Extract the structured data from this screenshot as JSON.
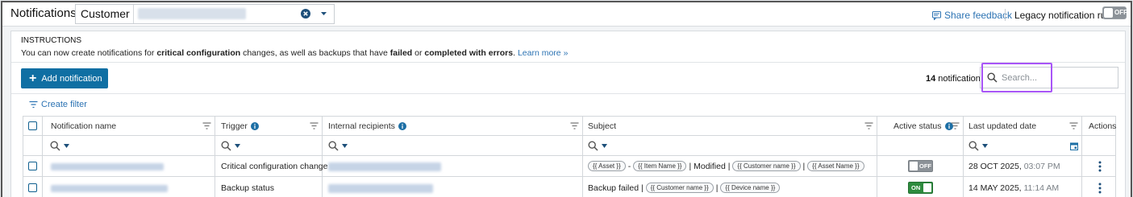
{
  "header": {
    "title": "Notifications",
    "customer_label": "Customer",
    "share_feedback": "Share feedback",
    "legacy_label": "Legacy notification rules",
    "legacy_toggle": "OFF"
  },
  "instructions": {
    "title": "INSTRUCTIONS",
    "p1": "You can now create notifications for ",
    "b1": "critical configuration",
    "p2": " changes, as well as backups that have ",
    "b2": "failed",
    "p3": " or ",
    "b3": "completed with errors",
    "p4": ".",
    "learn_more": "Learn more »"
  },
  "toolbar": {
    "add_label": "Add notification",
    "count_num": "14",
    "count_text": " notifications",
    "search_placeholder": "Search..."
  },
  "filters": {
    "create_filter": "Create filter"
  },
  "table": {
    "columns": {
      "name": "Notification name",
      "trigger": "Trigger",
      "recipients": "Internal recipients",
      "subject": "Subject",
      "active": "Active status",
      "updated": "Last updated date",
      "actions": "Actions"
    },
    "rows": [
      {
        "trigger": "Critical configuration change",
        "subject_tokens": [
          "{{ Asset }}",
          "-",
          "{{ Item Name }}",
          "| Modified |",
          "{{ Customer name }}",
          "|",
          "{{ Asset Name }}"
        ],
        "active": "OFF",
        "date": "28 OCT 2025,",
        "time": "03:07 PM"
      },
      {
        "trigger": "Backup status",
        "subject_prefix": "Backup failed |",
        "subject_tokens": [
          "{{ Customer name }}",
          "|",
          "{{ Device name }}"
        ],
        "active": "ON",
        "date": "14 MAY 2025,",
        "time": "11:14 AM"
      }
    ]
  },
  "colors": {
    "primary": "#0f6fa3",
    "link": "#2c73b3",
    "on": "#2e8b3e",
    "off": "#8c9298",
    "highlight": "#a855f7"
  }
}
